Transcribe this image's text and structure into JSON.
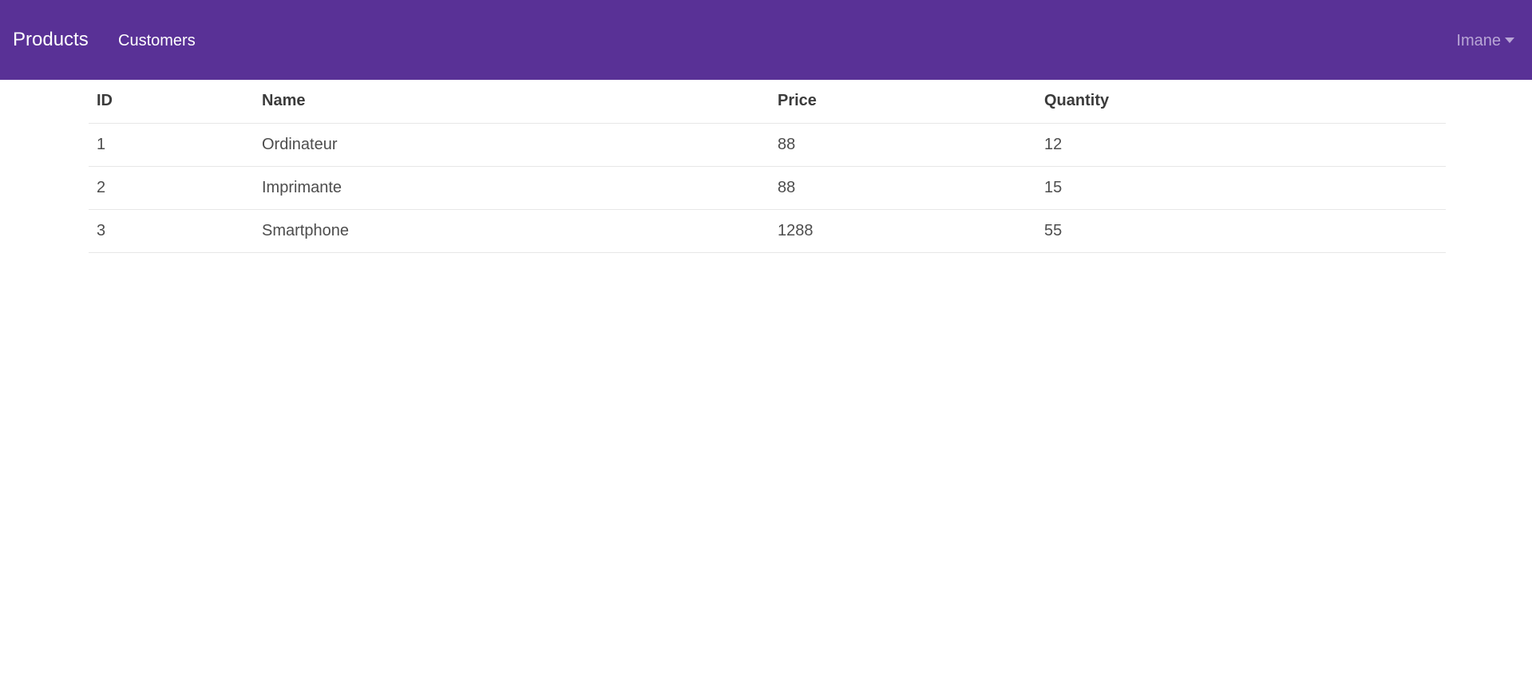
{
  "navbar": {
    "brand": "Products",
    "links": [
      {
        "label": "Customers"
      }
    ],
    "user": "Imane"
  },
  "table": {
    "headers": [
      "ID",
      "Name",
      "Price",
      "Quantity"
    ],
    "rows": [
      [
        "1",
        "Ordinateur",
        "88",
        "12"
      ],
      [
        "2",
        "Imprimante",
        "88",
        "15"
      ],
      [
        "3",
        "Smartphone",
        "1288",
        "55"
      ]
    ]
  },
  "colors": {
    "navbar_bg": "#593196",
    "navbar_text": "#ffffff",
    "user_menu_text": "#b9a6d6"
  }
}
